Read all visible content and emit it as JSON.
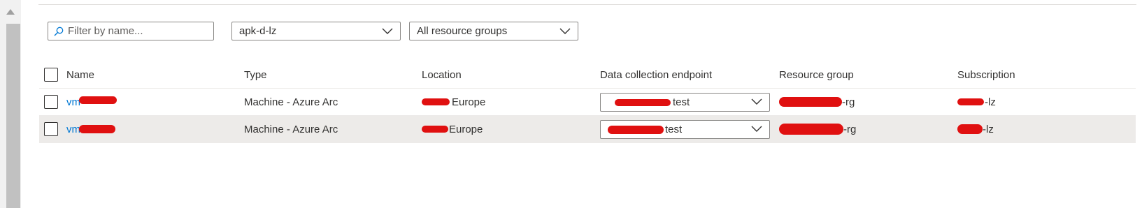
{
  "toolbar": {
    "filter_placeholder": "Filter by name...",
    "subscription_value": "apk-d-lz",
    "resource_group_value": "All resource groups"
  },
  "table": {
    "headers": {
      "name": "Name",
      "type": "Type",
      "location": "Location",
      "dce": "Data collection endpoint",
      "resource_group": "Resource group",
      "subscription": "Subscription"
    },
    "rows": [
      {
        "name_prefix": "vm",
        "type": "Machine - Azure Arc",
        "location_suffix": "Europe",
        "dce_suffix": "test",
        "resource_group_suffix": "-rg",
        "subscription_suffix": "-lz"
      },
      {
        "name_prefix": "vm",
        "type": "Machine - Azure Arc",
        "location_suffix": "Europe",
        "dce_suffix": "test",
        "resource_group_suffix": "-rg",
        "subscription_suffix": "-lz"
      }
    ]
  },
  "colors": {
    "link": "#0078d4",
    "redaction": "#e01010",
    "selected_row": "#edebe9"
  },
  "icons": {
    "filter": "search-icon",
    "dropdown": "chevron-down-icon",
    "scroll_up": "triangle-up-icon"
  }
}
